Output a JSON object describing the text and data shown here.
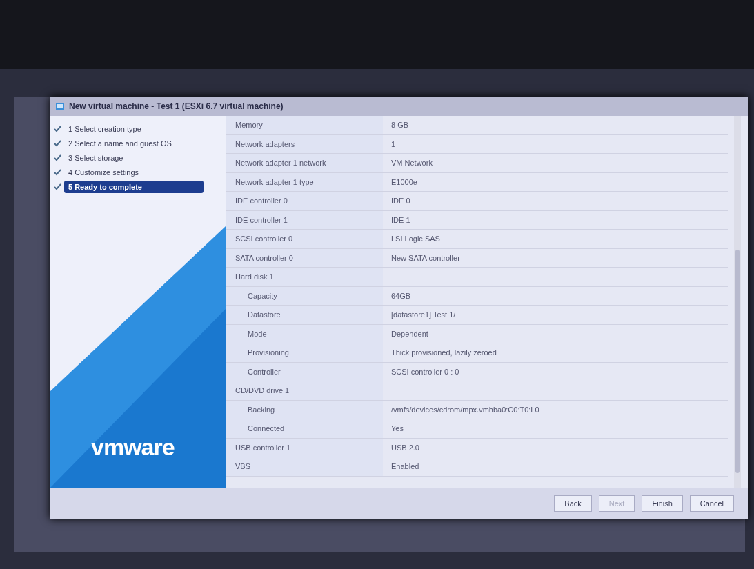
{
  "window": {
    "title": "New virtual machine - Test 1 (ESXi 6.7 virtual machine)"
  },
  "steps": [
    {
      "label": "1 Select creation type",
      "checked": true,
      "selected": false
    },
    {
      "label": "2 Select a name and guest OS",
      "checked": true,
      "selected": false
    },
    {
      "label": "3 Select storage",
      "checked": true,
      "selected": false
    },
    {
      "label": "4 Customize settings",
      "checked": true,
      "selected": false
    },
    {
      "label": "5 Ready to complete",
      "checked": true,
      "selected": true
    }
  ],
  "logo": "vmware",
  "settings": [
    {
      "name": "Memory",
      "value": "8 GB"
    },
    {
      "name": "Network adapters",
      "value": "1"
    },
    {
      "name": "Network adapter 1 network",
      "value": "VM Network"
    },
    {
      "name": "Network adapter 1 type",
      "value": "E1000e"
    },
    {
      "name": "IDE controller 0",
      "value": "IDE 0"
    },
    {
      "name": "IDE controller 1",
      "value": "IDE 1"
    },
    {
      "name": "SCSI controller 0",
      "value": "LSI Logic SAS"
    },
    {
      "name": "SATA controller 0",
      "value": "New SATA controller"
    },
    {
      "name": "Hard disk 1",
      "children": [
        {
          "name": "Capacity",
          "value": "64GB"
        },
        {
          "name": "Datastore",
          "value": "[datastore1] Test 1/"
        },
        {
          "name": "Mode",
          "value": "Dependent"
        },
        {
          "name": "Provisioning",
          "value": "Thick provisioned, lazily zeroed"
        },
        {
          "name": "Controller",
          "value": "SCSI controller 0 : 0"
        }
      ]
    },
    {
      "name": "CD/DVD drive 1",
      "children": [
        {
          "name": "Backing",
          "value": "/vmfs/devices/cdrom/mpx.vmhba0:C0:T0:L0"
        },
        {
          "name": "Connected",
          "value": "Yes"
        }
      ]
    },
    {
      "name": "USB controller 1",
      "value": "USB 2.0"
    },
    {
      "name": "VBS",
      "value": "Enabled"
    }
  ],
  "buttons": [
    {
      "label": "Back",
      "disabled": false
    },
    {
      "label": "Next",
      "disabled": true
    },
    {
      "label": "Finish",
      "disabled": false
    },
    {
      "label": "Cancel",
      "disabled": false
    }
  ]
}
